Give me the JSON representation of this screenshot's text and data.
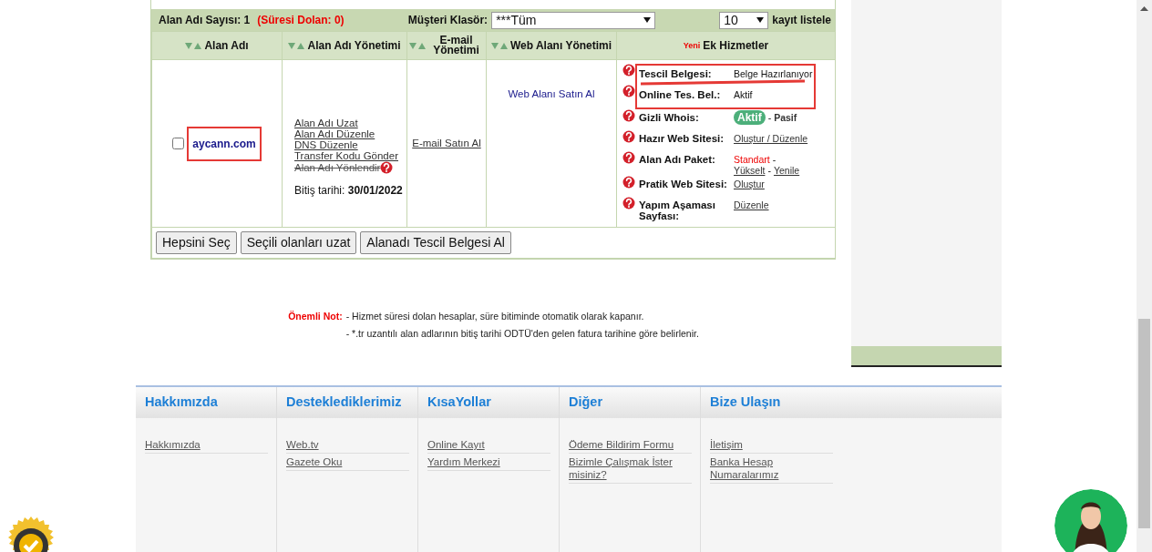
{
  "toolbar": {
    "count_label": "Alan Adı Sayısı: 1",
    "expired_label": "(Süresi Dolan: 0)",
    "folder_label": "Müşteri Klasör:",
    "folder_value": "***Tüm",
    "per_page_value": "10",
    "per_page_label": "kayıt listele"
  },
  "columns": [
    {
      "label": "Alan Adı",
      "sortable": true
    },
    {
      "label": "Alan Adı Yönetimi",
      "sortable": true
    },
    {
      "label": "E-mail Yönetimi",
      "sortable": true
    },
    {
      "label": "Web Alanı Yönetimi",
      "sortable": true
    },
    {
      "label": "Ek Hizmetler",
      "badge": "Yeni"
    }
  ],
  "rows": [
    {
      "checked": false,
      "domain": "aycann.com",
      "domain_annotated": true,
      "management_links": [
        {
          "text": "Alan Adı Uzat",
          "disabled": false
        },
        {
          "text": "Alan Adı Düzenle",
          "disabled": false
        },
        {
          "text": "DNS Düzenle",
          "disabled": false
        },
        {
          "text": "Transfer Kodu Gönder",
          "disabled": false
        },
        {
          "text": "Alan Adı Yönlendir",
          "disabled": true
        }
      ],
      "expiry_label": "Bitiş tarihi:",
      "expiry_date": "30/01/2022",
      "email_link": "E-mail Satın Al",
      "web_link": "Web Alanı Satın Al",
      "services": [
        {
          "label": "Tescil Belgesi:",
          "annotated": true,
          "underlined": true,
          "parts": [
            {
              "kind": "text",
              "text": "Belge Hazırlanıyor"
            }
          ]
        },
        {
          "label": "Online Tes. Bel.:",
          "annotated": true,
          "parts": [
            {
              "kind": "text",
              "text": "Aktif"
            }
          ]
        },
        {
          "label": "Gizli Whois:",
          "parts": [
            {
              "kind": "option",
              "text": "Aktif",
              "selected": true
            },
            {
              "kind": "sep",
              "text": "-"
            },
            {
              "kind": "option",
              "text": "Pasif",
              "selected": false
            }
          ]
        },
        {
          "label": "Hazır Web Sitesi:",
          "parts": [
            {
              "kind": "link",
              "text": "Oluştur / Düzenle"
            }
          ]
        },
        {
          "label": "Alan Adı Paket:",
          "parts": [
            {
              "kind": "current",
              "text": "Standart"
            },
            {
              "kind": "sep",
              "text": "-"
            },
            {
              "kind": "link",
              "text": "Yükselt"
            },
            {
              "kind": "sep",
              "text": "-"
            },
            {
              "kind": "link",
              "text": "Yenile"
            }
          ]
        },
        {
          "label": "Pratik Web Sitesi:",
          "parts": [
            {
              "kind": "link",
              "text": "Oluştur"
            }
          ]
        },
        {
          "label": "Yapım Aşaması Sayfası:",
          "parts": [
            {
              "kind": "link",
              "text": "Düzenle"
            }
          ]
        }
      ]
    }
  ],
  "buttons": [
    "Hepsini Seç",
    "Seçili olanları uzat",
    "Alanadı Tescil Belgesi Al"
  ],
  "note": {
    "label": "Önemli Not:",
    "lines": [
      "- Hizmet süresi dolan hesaplar, süre bitiminde otomatik olarak kapanır.",
      "- *.tr uzantılı alan adlarının bitiş tarihi ODTÜ'den gelen fatura tarihine göre belirlenir."
    ]
  },
  "footer": [
    {
      "title": "Hakkımızda",
      "links": [
        "Hakkımızda"
      ]
    },
    {
      "title": "Desteklediklerimiz",
      "links": [
        "Web.tv",
        "Gazete Oku"
      ]
    },
    {
      "title": "KısaYollar",
      "links": [
        "Online Kayıt",
        "Yardım Merkezi"
      ]
    },
    {
      "title": "Diğer",
      "links": [
        "Ödeme Bildirim Formu",
        "Bizimle Çalışmak İster misiniz?"
      ]
    },
    {
      "title": "Bize Ulaşın",
      "links": [
        "İletişim",
        "Banka Hesap Numaralarımız"
      ]
    }
  ]
}
